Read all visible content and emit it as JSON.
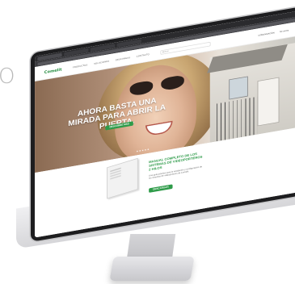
{
  "background": {
    "glyph": "O",
    "color": "#b9b9b9"
  },
  "site": {
    "logo": "Comelit",
    "nav": [
      "PRODUCTOS",
      "SOLUCIONES",
      "DESCARGAS",
      "CONTACTO"
    ],
    "search_placeholder": "Buscar",
    "header_right": [
      "COMUNICACIÓN",
      "Mi cuenta"
    ]
  },
  "hero": {
    "title": "AHORA BASTA UNA MIRADA PARA ABRIR LA PUERTA.",
    "button": "DESCUBRE MÁS"
  },
  "manual": {
    "title": "MANUAL COMPLETO DE LOS SISTEMAS DE VIDEOPORTEROS 2 HILOS",
    "text": "Una guía práctica para la instalación y configuración de los sistemas de videoporteros de Comelit.",
    "button": "DESCARGAR"
  },
  "colors": {
    "accent": "#2e9b49",
    "bezel": "#1d1d1f"
  }
}
